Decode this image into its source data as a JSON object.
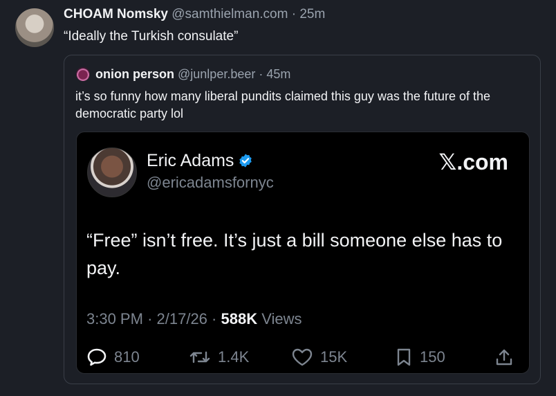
{
  "post": {
    "author_name": "CHOAM Nomsky",
    "handle": "@samthielman.com",
    "separator": "·",
    "time": "25m",
    "text": "“Ideally the Turkish consulate”"
  },
  "quote": {
    "author_name": "onion person",
    "handle": "@junlper.beer",
    "separator": "·",
    "time": "45m",
    "text": "it’s so funny how many liberal pundits claimed this guy was the future of the democratic party lol"
  },
  "embedded_tweet": {
    "author_name": "Eric Adams",
    "handle": "@ericadamsfornyc",
    "logo_text": "𝕏.com",
    "text": "“Free” isn’t free. It’s just a bill someone else has to pay.",
    "time": "3:30 PM",
    "date": "2/17/26",
    "views_count": "588K",
    "views_label": "Views",
    "dot": "·",
    "replies": "810",
    "reposts": "1.4K",
    "likes": "15K",
    "bookmarks": "150"
  },
  "colors": {
    "background": "#1c1f26",
    "card_background": "#000000",
    "verified_blue": "#1d9bf0",
    "muted_text": "#9aa3ae"
  },
  "icons": [
    "reply-icon",
    "repost-icon",
    "like-icon",
    "bookmark-icon",
    "share-icon",
    "verified-badge-icon"
  ]
}
